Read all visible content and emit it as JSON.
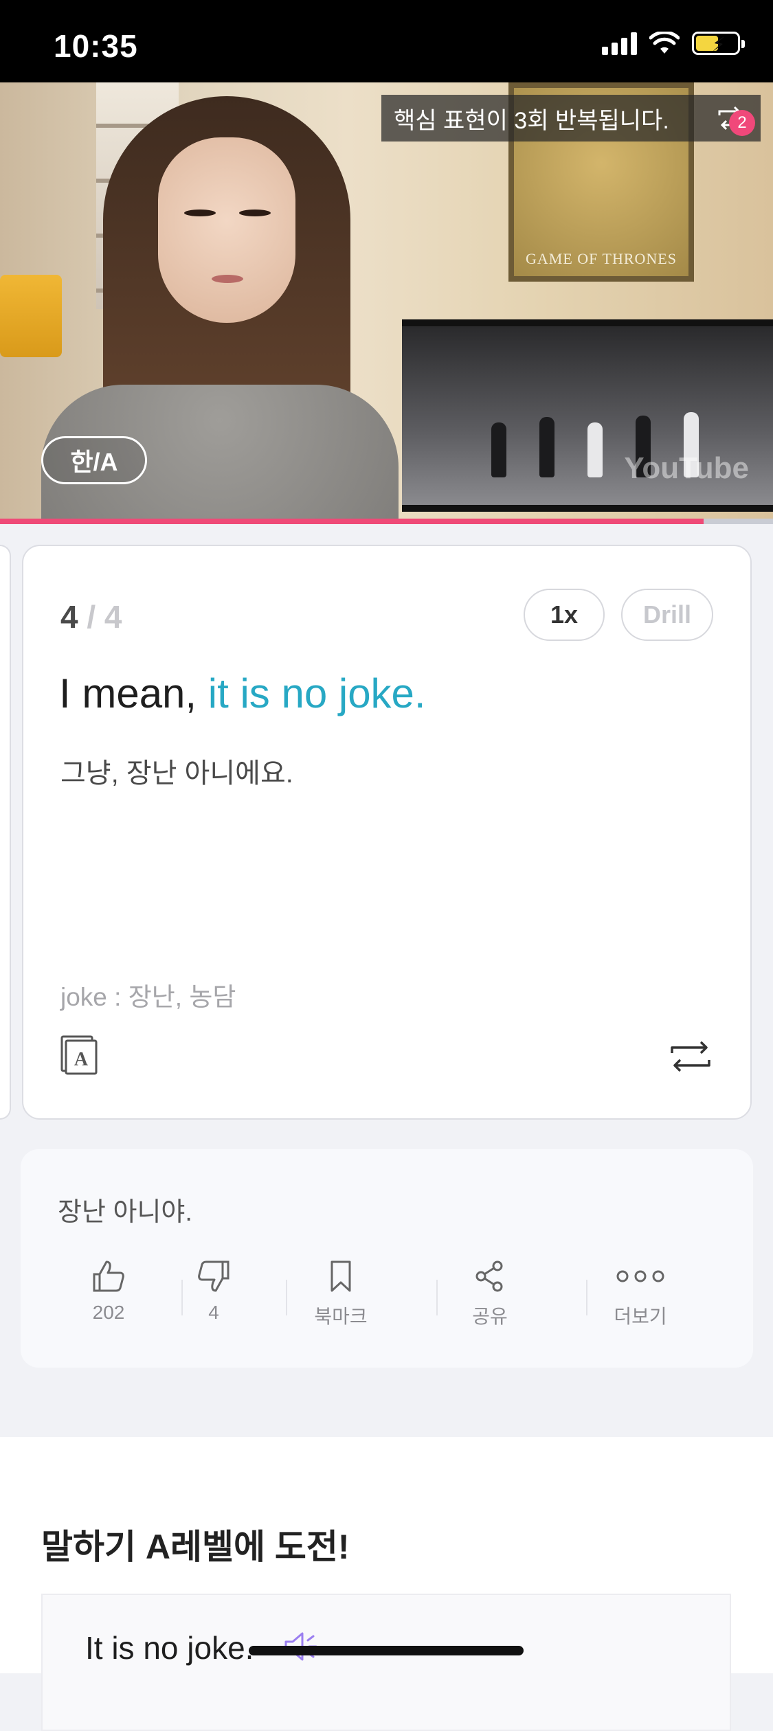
{
  "status_bar": {
    "time": "10:35"
  },
  "video": {
    "toast_text": "핵심 표현이 3회 반복됩니다.",
    "toast_badge": "2",
    "lang_toggle": "한/A",
    "poster_text": "GAME OF THRONES",
    "watermark": "YouTube",
    "progress": 0.91,
    "progress_color": "#ef4a77"
  },
  "card": {
    "current": "4",
    "total": "/ 4",
    "speed_label": "1x",
    "drill_label": "Drill",
    "sentence_prefix": "I mean, ",
    "sentence_highlight": "it is no joke.",
    "highlight_color": "#27a8c4",
    "translation": "그냥, 장난 아니에요.",
    "vocab": "joke : 장난, 농담",
    "icons": {
      "dictionary": "dictionary-icon",
      "repeat": "repeat-icon"
    }
  },
  "action_card": {
    "text": "장난 아니야.",
    "like_count": "202",
    "dislike_count": "4",
    "bookmark_label": "북마크",
    "share_label": "공유",
    "more_label": "더보기"
  },
  "lower": {
    "title": "말하기 A레벨에 도전!",
    "practice_text": "It is no joke."
  }
}
